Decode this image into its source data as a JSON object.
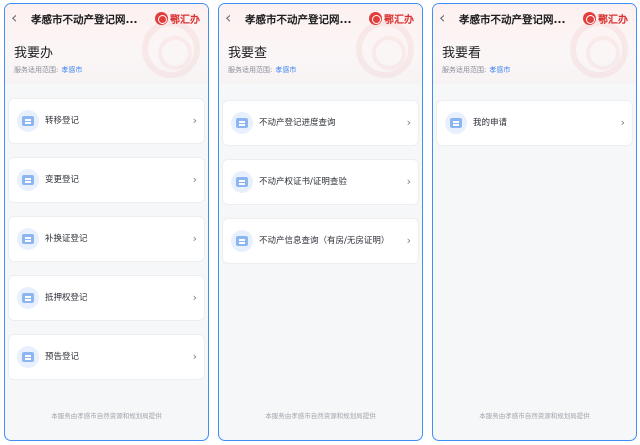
{
  "panels": [
    {
      "nav_title": "孝感市不动产登记网...",
      "logo_text": "鄂汇办",
      "heading": "我要办",
      "scope_label": "服务适用范围:",
      "scope_value": "孝感市",
      "items": [
        {
          "label": "转移登记",
          "icon": "document-icon"
        },
        {
          "label": "变更登记",
          "icon": "document-icon"
        },
        {
          "label": "补换证登记",
          "icon": "document-icon"
        },
        {
          "label": "抵押权登记",
          "icon": "document-icon"
        },
        {
          "label": "预告登记",
          "icon": "document-icon"
        }
      ],
      "footer": "本服务由孝感市自然资源和规划局提供"
    },
    {
      "nav_title": "孝感市不动产登记网...",
      "logo_text": "鄂汇办",
      "heading": "我要查",
      "scope_label": "服务适用范围:",
      "scope_value": "孝感市",
      "items": [
        {
          "label": "不动产登记进度查询",
          "icon": "document-icon"
        },
        {
          "label": "不动产权证书/证明查验",
          "icon": "document-icon"
        },
        {
          "label": "不动产信息查询（有房/无房证明）",
          "icon": "document-icon"
        }
      ],
      "footer": "本服务由孝感市自然资源和规划局提供"
    },
    {
      "nav_title": "孝感市不动产登记网...",
      "logo_text": "鄂汇办",
      "heading": "我要看",
      "scope_label": "服务适用范围:",
      "scope_value": "孝感市",
      "items": [
        {
          "label": "我的申请",
          "icon": "document-icon"
        }
      ],
      "footer": "本服务由孝感市自然资源和规划局提供"
    }
  ],
  "colors": {
    "frame_border": "#3f8ff6",
    "accent_blue": "#3d85f4",
    "brand_red": "#d9302f"
  }
}
